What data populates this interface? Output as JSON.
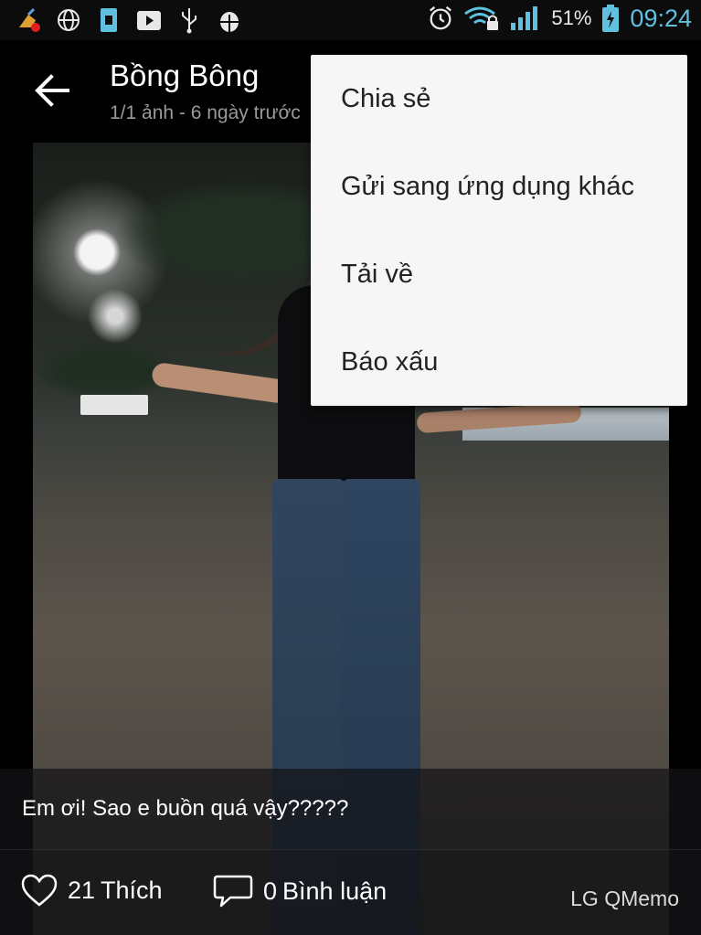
{
  "status_bar": {
    "battery_percent": "51%",
    "time": "09:24",
    "icons": [
      "cleaner-icon",
      "globe-icon",
      "sim-icon",
      "play-icon",
      "usb-icon",
      "android-debug-icon",
      "alarm-icon",
      "wifi-lock-icon",
      "signal-icon",
      "battery-charging-icon"
    ]
  },
  "header": {
    "title": "Bồng Bông",
    "subtitle": "1/1 ảnh - 6 ngày trước"
  },
  "menu": {
    "items": [
      {
        "label": "Chia sẻ"
      },
      {
        "label": "Gửi sang ứng dụng khác"
      },
      {
        "label": "Tải về"
      },
      {
        "label": "Báo xấu"
      }
    ]
  },
  "caption": "Em ơi! Sao e buồn quá vậy?????",
  "actions": {
    "like_count": "21",
    "like_label": "Thích",
    "comment_count": "0",
    "comment_label": "Bình luận"
  },
  "watermark": "LG QMemo"
}
